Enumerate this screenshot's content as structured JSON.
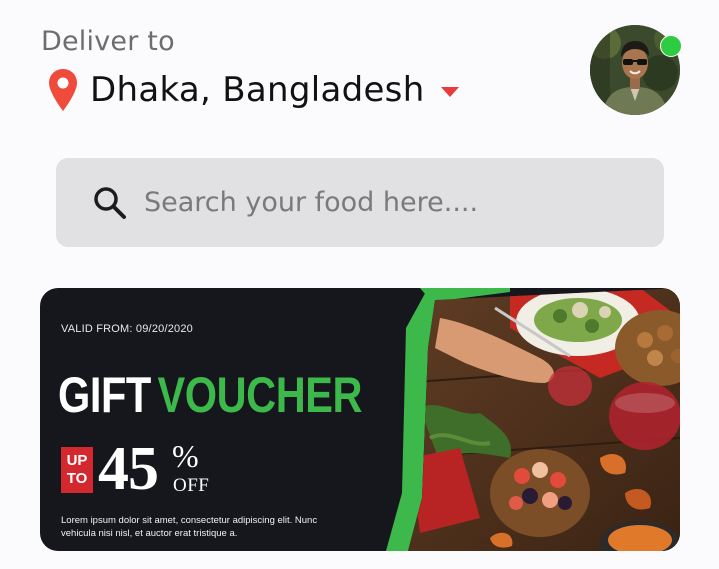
{
  "header": {
    "deliver_label": "Deliver to",
    "location": "Dhaka, Bangladesh",
    "pin_icon": "map-pin-icon",
    "dropdown_icon": "caret-down-icon",
    "avatar_status": "online",
    "avatar_status_color": "#2ecc40",
    "accent_color": "#e83b3b"
  },
  "search": {
    "placeholder": "Search your food here....",
    "value": "",
    "icon": "search-icon"
  },
  "banner": {
    "valid_from": "VALID FROM: 09/20/2020",
    "title_word1": "GIFT",
    "title_word2": "VOUCHER",
    "upto_line1": "UP",
    "upto_line2": "TO",
    "discount_number": "45",
    "discount_percent": "%",
    "discount_off": "OFF",
    "description": "Lorem ipsum dolor sit amet, consectetur adipiscing elit. Nunc vehicula nisi nisl, et auctor erat tristique a.",
    "accent_green": "#3cb94a",
    "accent_red": "#d3282e",
    "background": "#16171c"
  }
}
